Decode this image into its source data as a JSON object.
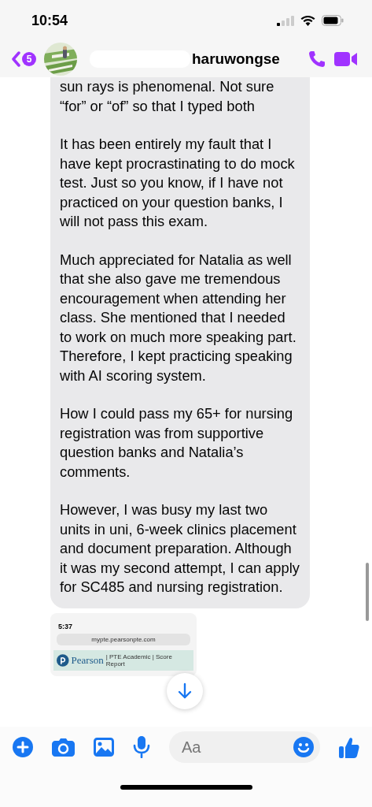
{
  "status_bar": {
    "time": "10:54"
  },
  "header": {
    "unread_count": "5",
    "contact_name": "haruwongse"
  },
  "message": {
    "paragraphs": [
      "sun rays is phenomenal. Not sure “for” or “of” so that I typed both",
      "It has been entirely my fault that I have kept procrastinating to do mock test. Just so you know, if I have not practiced on your question banks, I will not pass this exam.",
      "Much appreciated for Natalia as well that she also gave me tremendous encouragement when attending her class. She mentioned that I needed to work on much more speaking part. Therefore, I kept practicing speaking with AI scoring system.",
      "How I could pass my 65+ for nursing registration was from supportive question banks and Natalia’s comments.",
      "However, I was busy my last two units in uni, 6-week clinics placement and document preparation. Although it was my second attempt, I can apply for SC485 and nursing registration."
    ]
  },
  "attachment": {
    "time": "5:37",
    "url": "mypte.pearsonpte.com",
    "brand": "Pearson",
    "report_title": "| PTE Academic | Score Report"
  },
  "composer": {
    "placeholder": "Aa"
  }
}
